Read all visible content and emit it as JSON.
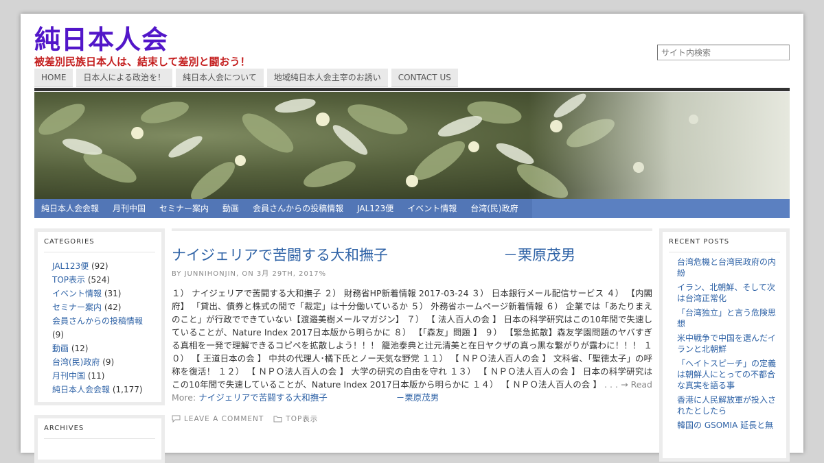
{
  "site": {
    "title": "純日本人会",
    "description": "被差別民族日本人は、結束して差別と闘おう！",
    "search_placeholder": "サイト内検索"
  },
  "top_nav": [
    "HOME",
    "日本人による政治を！",
    "純日本人会について",
    "地域純日本人会主宰のお誘い",
    "CONTACT US"
  ],
  "category_nav": [
    "純日本人会会報",
    "月刊中国",
    "セミナー案内",
    "動画",
    "会員さんからの投稿情報",
    "JAL123便",
    "イベント情報",
    "台湾(民)政府"
  ],
  "categories": {
    "title": "CATEGORIES",
    "items": [
      {
        "label": "JAL123便",
        "count": " (92)"
      },
      {
        "label": "TOP表示",
        "count": " (524)"
      },
      {
        "label": "イベント情報",
        "count": " (31)"
      },
      {
        "label": "セミナー案内",
        "count": " (42)"
      },
      {
        "label": "会員さんからの投稿情報",
        "count": " (9)"
      },
      {
        "label": "動画",
        "count": " (12)"
      },
      {
        "label": "台湾(民)政府",
        "count": " (9)"
      },
      {
        "label": "月刊中国",
        "count": " (11)"
      },
      {
        "label": "純日本人会会報",
        "count": " (1,177)"
      }
    ]
  },
  "archives": {
    "title": "ARCHIVES"
  },
  "recent_posts": {
    "title": "RECENT POSTS",
    "items": [
      "台湾危機と台湾民政府の内紛",
      "イラン、北朝鮮、そして次は台湾正常化",
      "「台湾独立」と言う危険思想",
      "米中戦争で中国を選んだイランと北朝鮮",
      "「ヘイトスピーチ」の定義は朝鮮人にとっての不都合な真実を語る事",
      "香港に人民解放軍が投入されたとしたら",
      "韓国の GSOMIA 延長と無"
    ]
  },
  "post": {
    "title": "ナイジェリアで苦闘する大和撫子　　　　　　　　－栗原茂男",
    "meta": "BY JUNNIHONJIN, ON 3月 29TH, 2017%",
    "body": "１） ナイジェリアで苦闘する大和撫子 ２） 財務省HP新着情報 2017-03-24 ３） 日本銀行メール配信サービス ４） 【内閣府】 「貸出、債券と株式の間で「裁定」は十分働いているか ５） 外務省ホームページ新着情報 ６） 企業では「あたりまえのこと」が行政でできていない【渡邉美樹メールマガジン】 ７） 【 法人百人の会 】 日本の科学研究はこの10年間で失速していることが、Nature Index 2017日本版から明らかに ８） 【「森友」問題 】 ９） 【緊急拡散】森友学園問題のヤバすぎる真相を一発で理解できるコピペを拡散しよう！！！ 籠池泰典と辻元清美と在日ヤクザの真っ黒な繋がりが露わに！！！ １０） 【 王道日本の会 】 中共の代理人･橘下氏とノー天気な野党 １１） 【 ＮＰＯ法人百人の会 】 文科省、「聖徳太子」の呼称を復活！ １２） 【 ＮＰＯ法人百人の会 】 大学の研究の自由を守れ １３） 【 ＮＰＯ法人百人の会 】 日本の科学研究はこの10年間で失速していることが、Nature Index 2017日本版から明らかに １４） 【 ＮＰＯ法人百人の会 】",
    "ellipsis": " . . . → Read More: ",
    "read_more_link": "ナイジェリアで苦闘する大和撫子　　　　　　　　－栗原茂男",
    "comment_label": "LEAVE A COMMENT",
    "category_label": "TOP表示"
  },
  "colors": {
    "title": "#5216c9",
    "description": "#c41f1f",
    "link": "#2e62a6",
    "category_nav": "#5276b6"
  }
}
